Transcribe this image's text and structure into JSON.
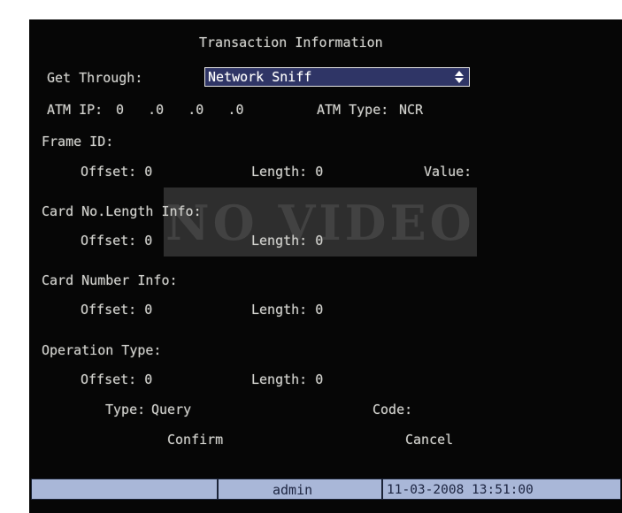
{
  "dialog": {
    "title": "Transaction Information",
    "get_through_label": "Get Through:",
    "get_through_value": "Network Sniff",
    "atm_ip_label": "ATM IP:",
    "atm_ip_value": "0   .0   .0   .0",
    "atm_type_label": "ATM Type:",
    "atm_type_value": "NCR",
    "frame_id": {
      "heading": "Frame ID:",
      "offset": "Offset: 0",
      "length": "Length: 0",
      "value": "Value:"
    },
    "card_no_length": {
      "heading": "Card No.Length Info:",
      "offset": "Offset: 0",
      "length": "Length: 0"
    },
    "card_number": {
      "heading": "Card Number Info:",
      "offset": "Offset: 0",
      "length": "Length: 0"
    },
    "operation_type": {
      "heading": "Operation Type:",
      "offset": "Offset: 0",
      "length": "Length: 0",
      "type_label": "Type:",
      "type_value": "Query",
      "code_label": "Code:"
    },
    "confirm_label": "Confirm",
    "cancel_label": "Cancel"
  },
  "overlay": {
    "no_video": "NO VIDEO"
  },
  "status_bar": {
    "user": "admin",
    "datetime": "11-03-2008 13:51:00"
  },
  "icons": {
    "select_arrows": "spinner-updown-icon"
  },
  "colors": {
    "background": "#060606",
    "text": "#d0d0cc",
    "select_bg": "#2f3566",
    "status_bg": "#a9b7d8",
    "status_text": "#1c2440",
    "no_video_box": "#2e2e2e"
  }
}
